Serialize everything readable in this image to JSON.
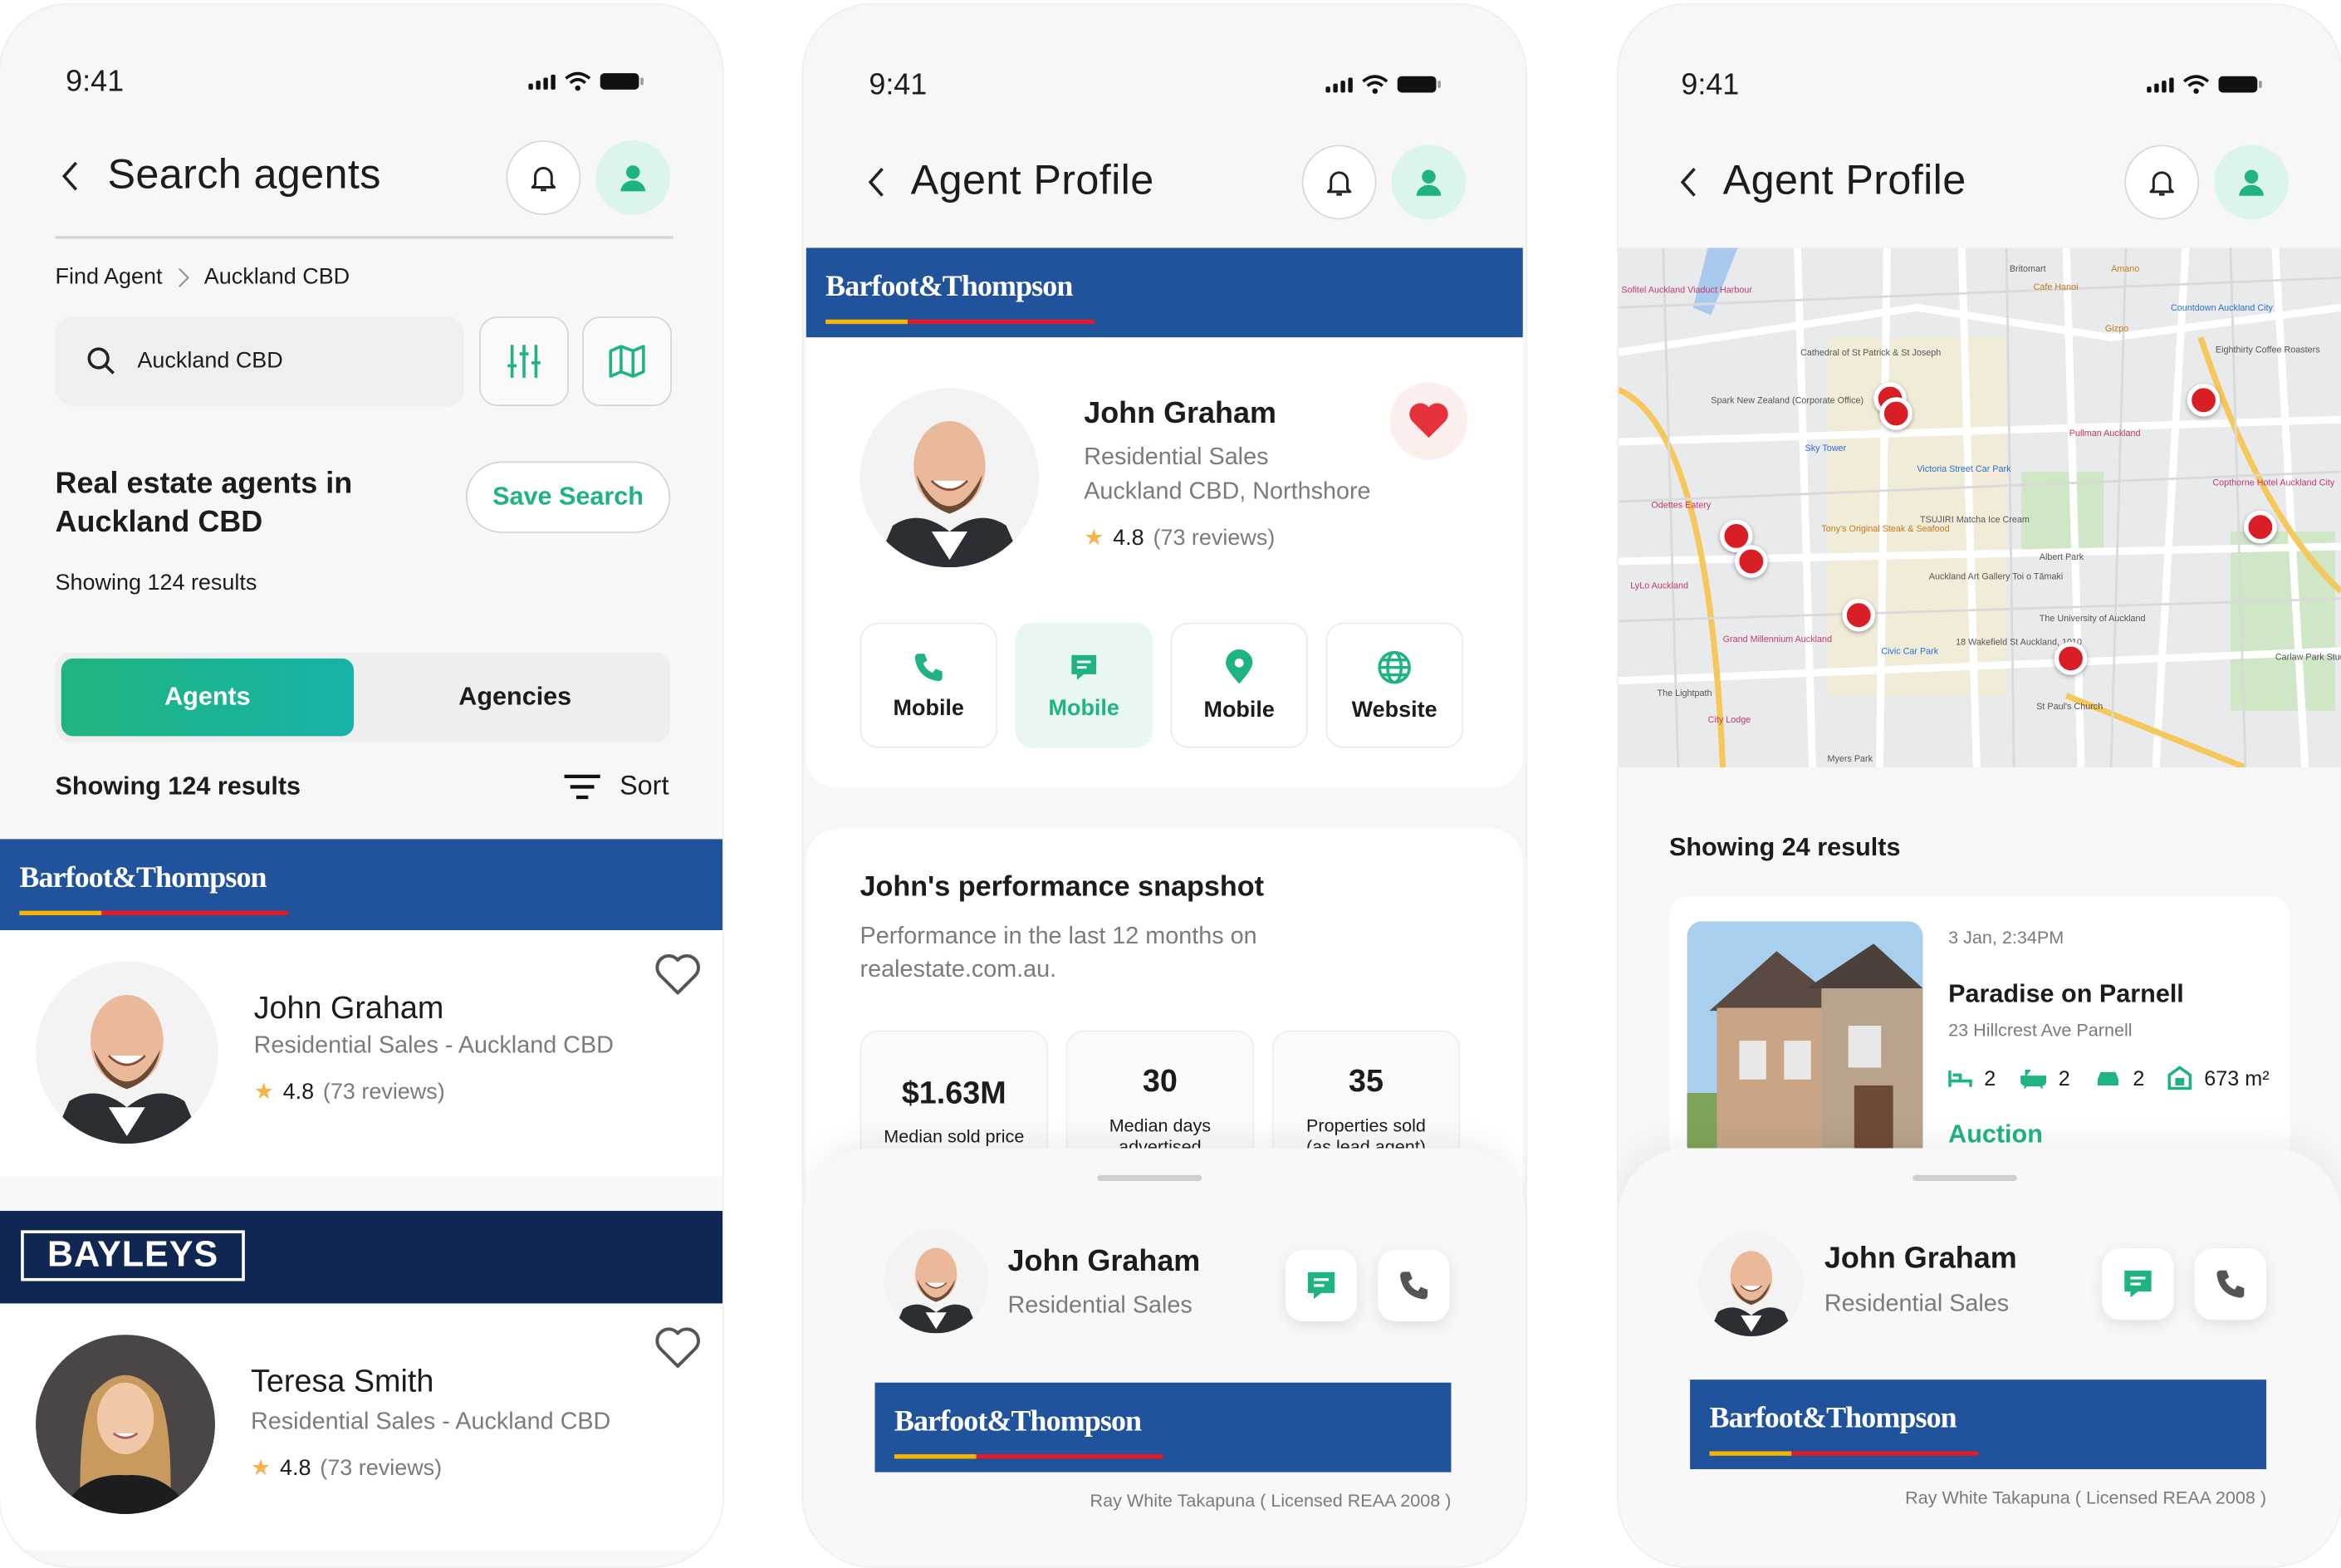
{
  "colors": {
    "accent_green": "#1fb47f",
    "brand_blue": "#21529c",
    "bayleys_navy": "#0f2752",
    "heart_red": "#e6323a"
  },
  "status": {
    "time": "9:41"
  },
  "screen1": {
    "title": "Search agents",
    "breadcrumb": {
      "root": "Find Agent",
      "current": "Auckland CBD"
    },
    "search": {
      "value": "Auckland CBD"
    },
    "heading": "Real estate agents in Auckland CBD",
    "save_search": "Save Search",
    "showing_small": "Showing 124 results",
    "tabs": [
      "Agents",
      "Agencies"
    ],
    "showing": "Showing 124 results",
    "sort": "Sort",
    "agents": [
      {
        "brand": "Barfoot&Thompson",
        "name": "John Graham",
        "role": "Residential Sales - Auckland CBD",
        "rating": "4.8",
        "reviews": "(73 reviews)"
      },
      {
        "brand": "BAYLEYS",
        "name": "Teresa Smith",
        "role": "Residential Sales - Auckland CBD",
        "rating": "4.8",
        "reviews": "(73 reviews)"
      }
    ]
  },
  "screen2": {
    "title": "Agent Profile",
    "brand": "Barfoot&Thompson",
    "agent": {
      "name": "John Graham",
      "role": "Residential Sales",
      "area": "Auckland CBD, Northshore",
      "rating": "4.8",
      "reviews": "(73 reviews)"
    },
    "actions": [
      "Mobile",
      "Mobile",
      "Mobile",
      "Website"
    ],
    "snapshot": {
      "title": "John's performance snapshot",
      "desc": "Performance in the last 12 months on realestate.com.au."
    },
    "stats": [
      {
        "value": "$1.63M",
        "label": "Median sold price"
      },
      {
        "value": "30",
        "label": "Median days advertised"
      },
      {
        "value": "35",
        "label": "Properties sold (as lead agent)"
      }
    ],
    "sheet": {
      "name": "John Graham",
      "role": "Residential Sales",
      "license": "Ray White Takapuna ( Licensed REAA 2008 )"
    }
  },
  "screen3": {
    "title": "Agent Profile",
    "map": {
      "labels": [
        "Sofitel Auckland Viaduct Harbour",
        "Spark New Zealand (Corporate Office)",
        "Sky Tower",
        "Cathedral of St Patrick & St Joseph",
        "Britomart",
        "Countdown Auckland City",
        "Eighthirty Coffee Roasters",
        "Victoria Street Car Park",
        "Pullman Auckland",
        "Albert Park",
        "Auckland Art Gallery Toi o Tāmaki",
        "The University of Auckland",
        "Copthorne Hotel Auckland City",
        "Odettes Eatery",
        "LyLo Auckland",
        "Grand Millennium Auckland",
        "Civic Car Park",
        "18 Wakefield St Auckland, 1010",
        "City Lodge",
        "The Lightpath",
        "St Paul's Church",
        "Carlaw Park Student Village",
        "Myers Park",
        "Amano",
        "Cafe Hanoi",
        "Gizpo",
        "Tony's Original Steak & Seafood",
        "TSUJIRI Matcha Ice Cream"
      ]
    },
    "showing": "Showing 24 results",
    "listing": {
      "date": "3 Jan, 2:34PM",
      "title": "Paradise on Parnell",
      "address": "23 Hillcrest Ave Parnell",
      "beds": "2",
      "baths": "2",
      "cars": "2",
      "area": "673 m²",
      "type": "Auction"
    },
    "sheet": {
      "name": "John Graham",
      "role": "Residential Sales",
      "license": "Ray White Takapuna ( Licensed REAA 2008 )"
    }
  }
}
